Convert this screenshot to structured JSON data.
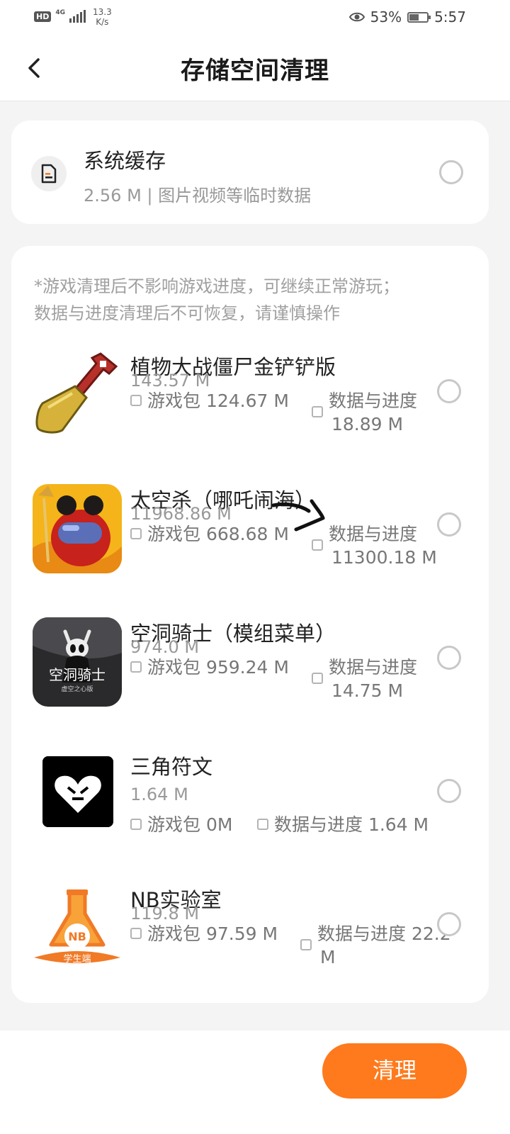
{
  "status_bar": {
    "hd": "HD",
    "network": "4G",
    "speed_value": "13.3",
    "speed_unit": "K/s",
    "battery_percent": "53%",
    "battery_level": 0.53,
    "time": "5:57"
  },
  "header": {
    "title": "存储空间清理",
    "back_icon": "chevron-left-icon"
  },
  "cache": {
    "title": "系统缓存",
    "subtitle": "2.56 M | 图片视频等临时数据",
    "icon": "document-icon",
    "selected": false
  },
  "notice": {
    "line1": "*游戏清理后不影响游戏进度，可继续正常游玩；",
    "line2": "数据与进度清理后不可恢复，请谨慎操作"
  },
  "games": [
    {
      "name": "植物大战僵尸金铲铲版",
      "total": "143.57 M",
      "package_label": "游戏包 124.67 M",
      "data_label": "数据与进度",
      "data_value": "18.89 M",
      "icon": "golden-shovel-icon",
      "selected": false
    },
    {
      "name": "太空杀（哪吒闹海）",
      "total": "11968.86 M",
      "package_label": "游戏包 668.68 M",
      "data_label": "数据与进度",
      "data_value": "11300.18 M",
      "icon": "space-crewmate-icon",
      "selected": false
    },
    {
      "name": "空洞骑士（模组菜单）",
      "total": "974.0 M",
      "package_label": "游戏包 959.24 M",
      "data_label": "数据与进度",
      "data_value": "14.75 M",
      "icon": "hollow-knight-icon",
      "icon_text": "空洞骑士",
      "icon_subtext": "虚空之心版",
      "selected": false
    },
    {
      "name": "三角符文",
      "total": "1.64 M",
      "package_label": "游戏包 0M",
      "data_label": "数据与进度 1.64 M",
      "icon": "heart-icon",
      "selected": false
    },
    {
      "name": "NB实验室",
      "total": "119.8 M",
      "package_label": "游戏包 97.59 M",
      "data_label": "数据与进度 22.2",
      "data_value": "M",
      "icon": "flask-icon",
      "icon_text": "NB",
      "icon_subtext": "学生端",
      "selected": false
    }
  ],
  "footer": {
    "clean_label": "清理"
  },
  "colors": {
    "accent": "#fe7a1c",
    "background": "#f4f4f4",
    "card": "#ffffff",
    "secondary_text": "#999999"
  }
}
